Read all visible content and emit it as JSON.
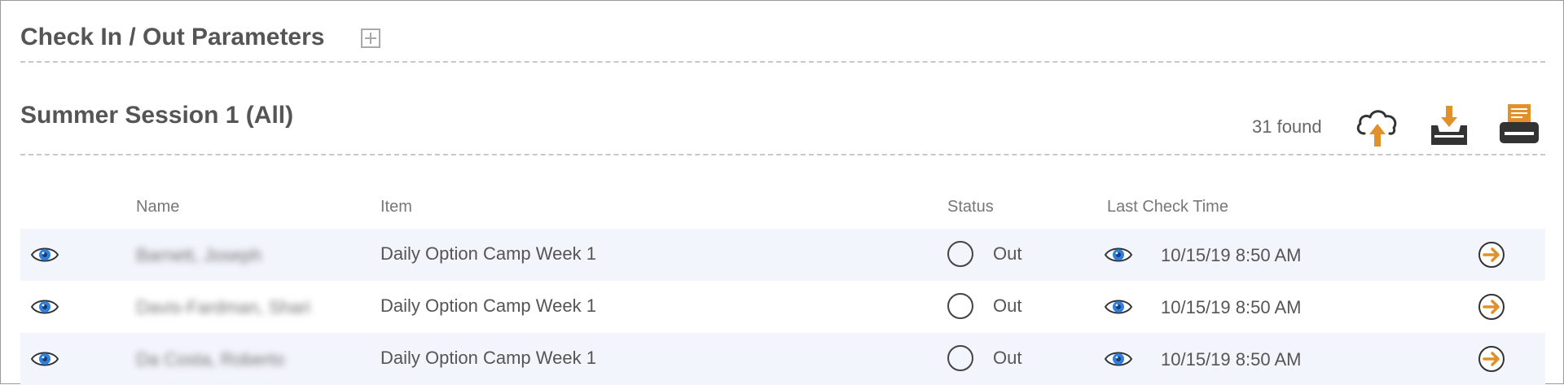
{
  "params": {
    "title": "Check In / Out Parameters",
    "expand_icon": "plus-square-icon"
  },
  "session": {
    "title": "Summer Session 1 (All)",
    "found": "31 found",
    "tools": [
      {
        "icon": "cloud-upload-icon"
      },
      {
        "icon": "tray-download-icon"
      },
      {
        "icon": "printer-icon"
      }
    ]
  },
  "table": {
    "columns": [
      "Name",
      "Item",
      "Status",
      "Last Check Time"
    ],
    "rows": [
      {
        "name": "Barnett, Joseph",
        "item": "Daily Option Camp Week 1",
        "status": "Out",
        "time": "10/15/19 8:50 AM"
      },
      {
        "name": "Davis-Fardman, Shari",
        "item": "Daily Option Camp Week 1",
        "status": "Out",
        "time": "10/15/19 8:50 AM"
      },
      {
        "name": "Da Costa, Roberto",
        "item": "Daily Option Camp Week 1",
        "status": "Out",
        "time": "10/15/19 8:50 AM"
      }
    ]
  },
  "colors": {
    "accent": "#e0912a",
    "eye_blue": "#2f7fe0",
    "row_alt": "#f2f5fc"
  }
}
